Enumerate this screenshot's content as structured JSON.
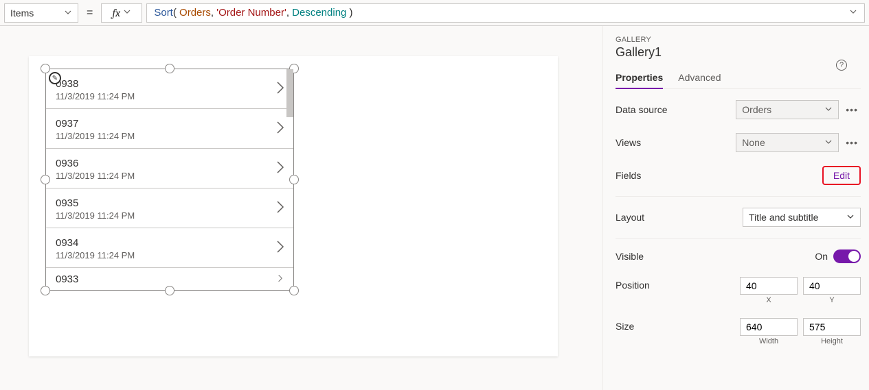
{
  "formulaBar": {
    "property": "Items",
    "fx": "fx",
    "formula": {
      "fn": "Sort",
      "open": "( ",
      "ds": "Orders",
      "c1": ", ",
      "str": "'Order Number'",
      "c2": ", ",
      "kw": "Descending",
      "close": " )"
    }
  },
  "gallery": {
    "items": [
      {
        "title": "0938",
        "subtitle": "11/3/2019 11:24 PM"
      },
      {
        "title": "0937",
        "subtitle": "11/3/2019 11:24 PM"
      },
      {
        "title": "0936",
        "subtitle": "11/3/2019 11:24 PM"
      },
      {
        "title": "0935",
        "subtitle": "11/3/2019 11:24 PM"
      },
      {
        "title": "0934",
        "subtitle": "11/3/2019 11:24 PM"
      },
      {
        "title": "0933",
        "subtitle": ""
      }
    ]
  },
  "panel": {
    "sectionLabel": "GALLERY",
    "sectionTitle": "Gallery1",
    "tabs": {
      "properties": "Properties",
      "advanced": "Advanced"
    },
    "dataSource": {
      "label": "Data source",
      "value": "Orders"
    },
    "views": {
      "label": "Views",
      "value": "None"
    },
    "fields": {
      "label": "Fields",
      "action": "Edit"
    },
    "layout": {
      "label": "Layout",
      "value": "Title and subtitle"
    },
    "visible": {
      "label": "Visible",
      "state": "On"
    },
    "position": {
      "label": "Position",
      "x": "40",
      "y": "40",
      "xLabel": "X",
      "yLabel": "Y"
    },
    "size": {
      "label": "Size",
      "w": "640",
      "h": "575",
      "wLabel": "Width",
      "hLabel": "Height"
    }
  },
  "equals": "="
}
